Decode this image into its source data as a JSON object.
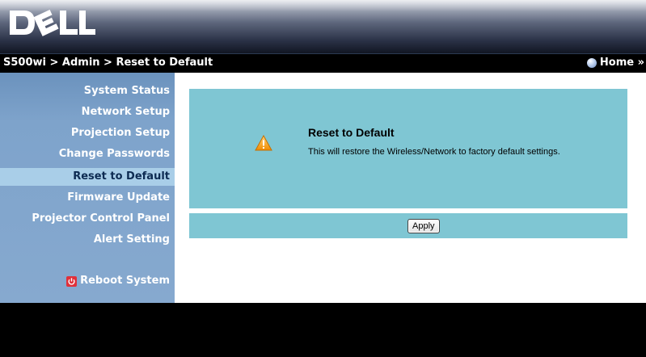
{
  "brand": {
    "logo_text": "DELL"
  },
  "breadcrumb": {
    "text": "S500wi > Admin > Reset to Default"
  },
  "home": {
    "label": "Home »"
  },
  "sidebar": {
    "items": [
      {
        "label": "System Status"
      },
      {
        "label": "Network Setup"
      },
      {
        "label": "Projection Setup"
      },
      {
        "label": "Change Passwords"
      },
      {
        "label": "Reset to Default",
        "active": true
      },
      {
        "label": "Firmware Update"
      },
      {
        "label": "Projector Control Panel"
      },
      {
        "label": "Alert Setting"
      }
    ],
    "reboot": {
      "label": "Reboot System",
      "icon": "power-icon"
    }
  },
  "panel": {
    "icon": "warning-icon",
    "title": "Reset to Default",
    "message": "This will restore the Wireless/Network to factory default settings."
  },
  "apply": {
    "label": "Apply"
  },
  "colors": {
    "sidebar_bg": "#7ea3cb",
    "sidebar_active": "#a9cee8",
    "panel_bg": "#7fc6d3",
    "warning": "#f4a21c"
  }
}
